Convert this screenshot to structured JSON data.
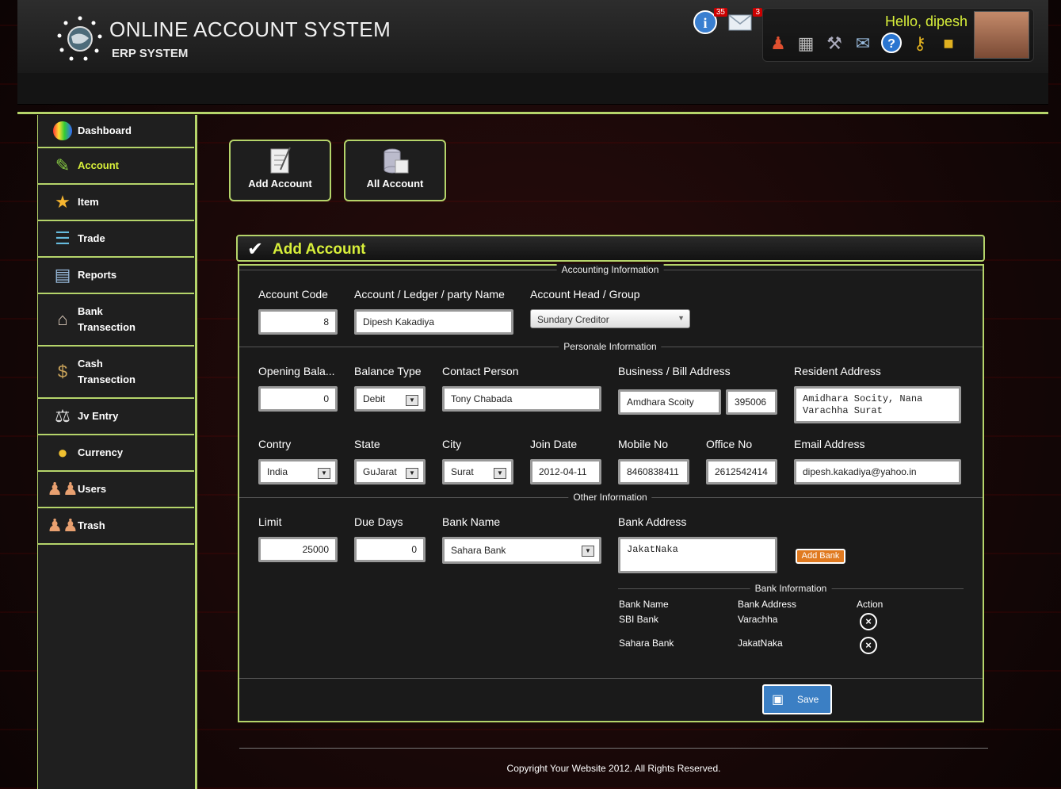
{
  "header": {
    "title": "ONLINE ACCOUNT SYSTEM",
    "subtitle": "ERP SYSTEM",
    "greeting": "Hello, dipesh",
    "info_count": "35",
    "mail_count": "3"
  },
  "sidebar": {
    "items": [
      {
        "label": "Dashboard"
      },
      {
        "label": "Account"
      },
      {
        "label": "Item"
      },
      {
        "label": "Trade"
      },
      {
        "label": "Reports"
      },
      {
        "label": "Bank Transection"
      },
      {
        "label": "Cash Transection"
      },
      {
        "label": "Jv Entry"
      },
      {
        "label": "Currency"
      },
      {
        "label": "Users"
      },
      {
        "label": "Trash"
      }
    ]
  },
  "quick": {
    "add": "Add Account",
    "all": "All Account"
  },
  "panel": {
    "title": "Add Account"
  },
  "sections": {
    "accounting": "Accounting Information",
    "personal": "Personale Information",
    "other": "Other Information",
    "bank": "Bank Information"
  },
  "labels": {
    "account_code": "Account Code",
    "ledger_name": "Account / Ledger / party Name",
    "head": "Account Head / Group",
    "opening": "Opening Bala...",
    "balance_type": "Balance Type",
    "contact": "Contact Person",
    "business": "Business / Bill Address",
    "resident": "Resident Address",
    "country": "Contry",
    "state": "State",
    "city": "City",
    "join": "Join Date",
    "mobile": "Mobile No",
    "office": "Office No",
    "email": "Email Address",
    "limit": "Limit",
    "due": "Due Days",
    "bank_name": "Bank Name",
    "bank_address": "Bank Address"
  },
  "values": {
    "account_code": "8",
    "ledger_name": "Dipesh Kakadiya",
    "head": "Sundary Creditor",
    "opening": "0",
    "balance_type": "Debit",
    "contact": "Tony Chabada",
    "business": "Amdhara Scoity",
    "pin": "395006",
    "resident": "Amidhara Socity, Nana Varachha Surat",
    "country": "India",
    "state": "GuJarat",
    "city": "Surat",
    "join": "2012-04-11",
    "mobile": "8460838411",
    "office": "2612542414",
    "email": "dipesh.kakadiya@yahoo.in",
    "limit": "25000",
    "due": "0",
    "bank_name": "Sahara Bank",
    "bank_address": "JakatNaka"
  },
  "buttons": {
    "add_bank": "Add Bank",
    "save": "Save"
  },
  "bank_table": {
    "headers": [
      "Bank Name",
      "Bank Address",
      "Action"
    ],
    "rows": [
      {
        "name": "SBI Bank",
        "address": "Varachha"
      },
      {
        "name": "Sahara Bank",
        "address": "JakatNaka"
      }
    ]
  },
  "footer": "Copyright Your Website 2012. All Rights Reserved.",
  "colors": {
    "accent": "#b5d46a",
    "highlight": "#d8ef3a",
    "save": "#3b7fc4",
    "add_bank": "#e07a20"
  }
}
